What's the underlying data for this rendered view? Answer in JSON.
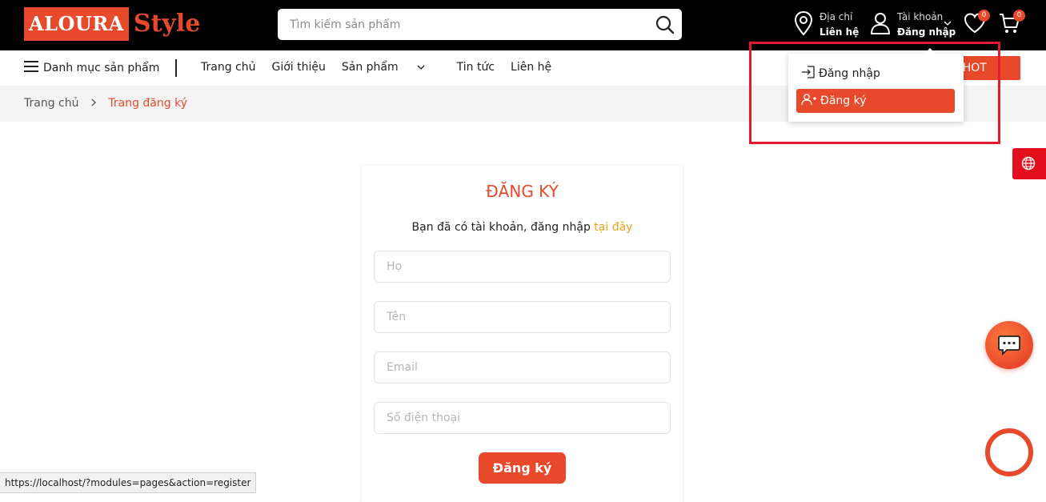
{
  "header": {
    "logo_left": "ALOURA",
    "logo_right": "Style",
    "search_placeholder": "Tìm kiếm sản phẩm",
    "address_label": "Địa chỉ",
    "address_value": "Liên hệ",
    "account_label": "Tài khoản",
    "account_value": "Đăng nhập",
    "wishlist_count": "0",
    "cart_count": "0"
  },
  "nav": {
    "categories": "Danh mục sản phẩm",
    "links": [
      "Trang chủ",
      "Giới thiệu",
      "Sản phẩm",
      "Tin tức",
      "Liên hệ"
    ],
    "promo": "Khuyến mãi HOT"
  },
  "breadcrumb": {
    "home": "Trang chủ",
    "current": "Trang đăng ký"
  },
  "account_dropdown": {
    "items": [
      {
        "label": "Đăng nhập",
        "icon": "login-icon"
      },
      {
        "label": "Đăng ký",
        "icon": "user-plus-icon",
        "active": true
      }
    ]
  },
  "form": {
    "title": "ĐĂNG KÝ",
    "subtitle_text": "Bạn đã có tài khoản, đăng nhập ",
    "subtitle_link": "tại đây",
    "fields": [
      {
        "placeholder": "Họ"
      },
      {
        "placeholder": "Tên"
      },
      {
        "placeholder": "Email"
      },
      {
        "placeholder": "Số điện thoại"
      }
    ],
    "submit": "Đăng ký"
  },
  "status_url": "https://localhost/?modules=pages&action=register",
  "colors": {
    "accent": "#e8492b",
    "header_bg": "#000000",
    "highlight_box": "#e01b2d",
    "link_orange": "#f0a020"
  }
}
